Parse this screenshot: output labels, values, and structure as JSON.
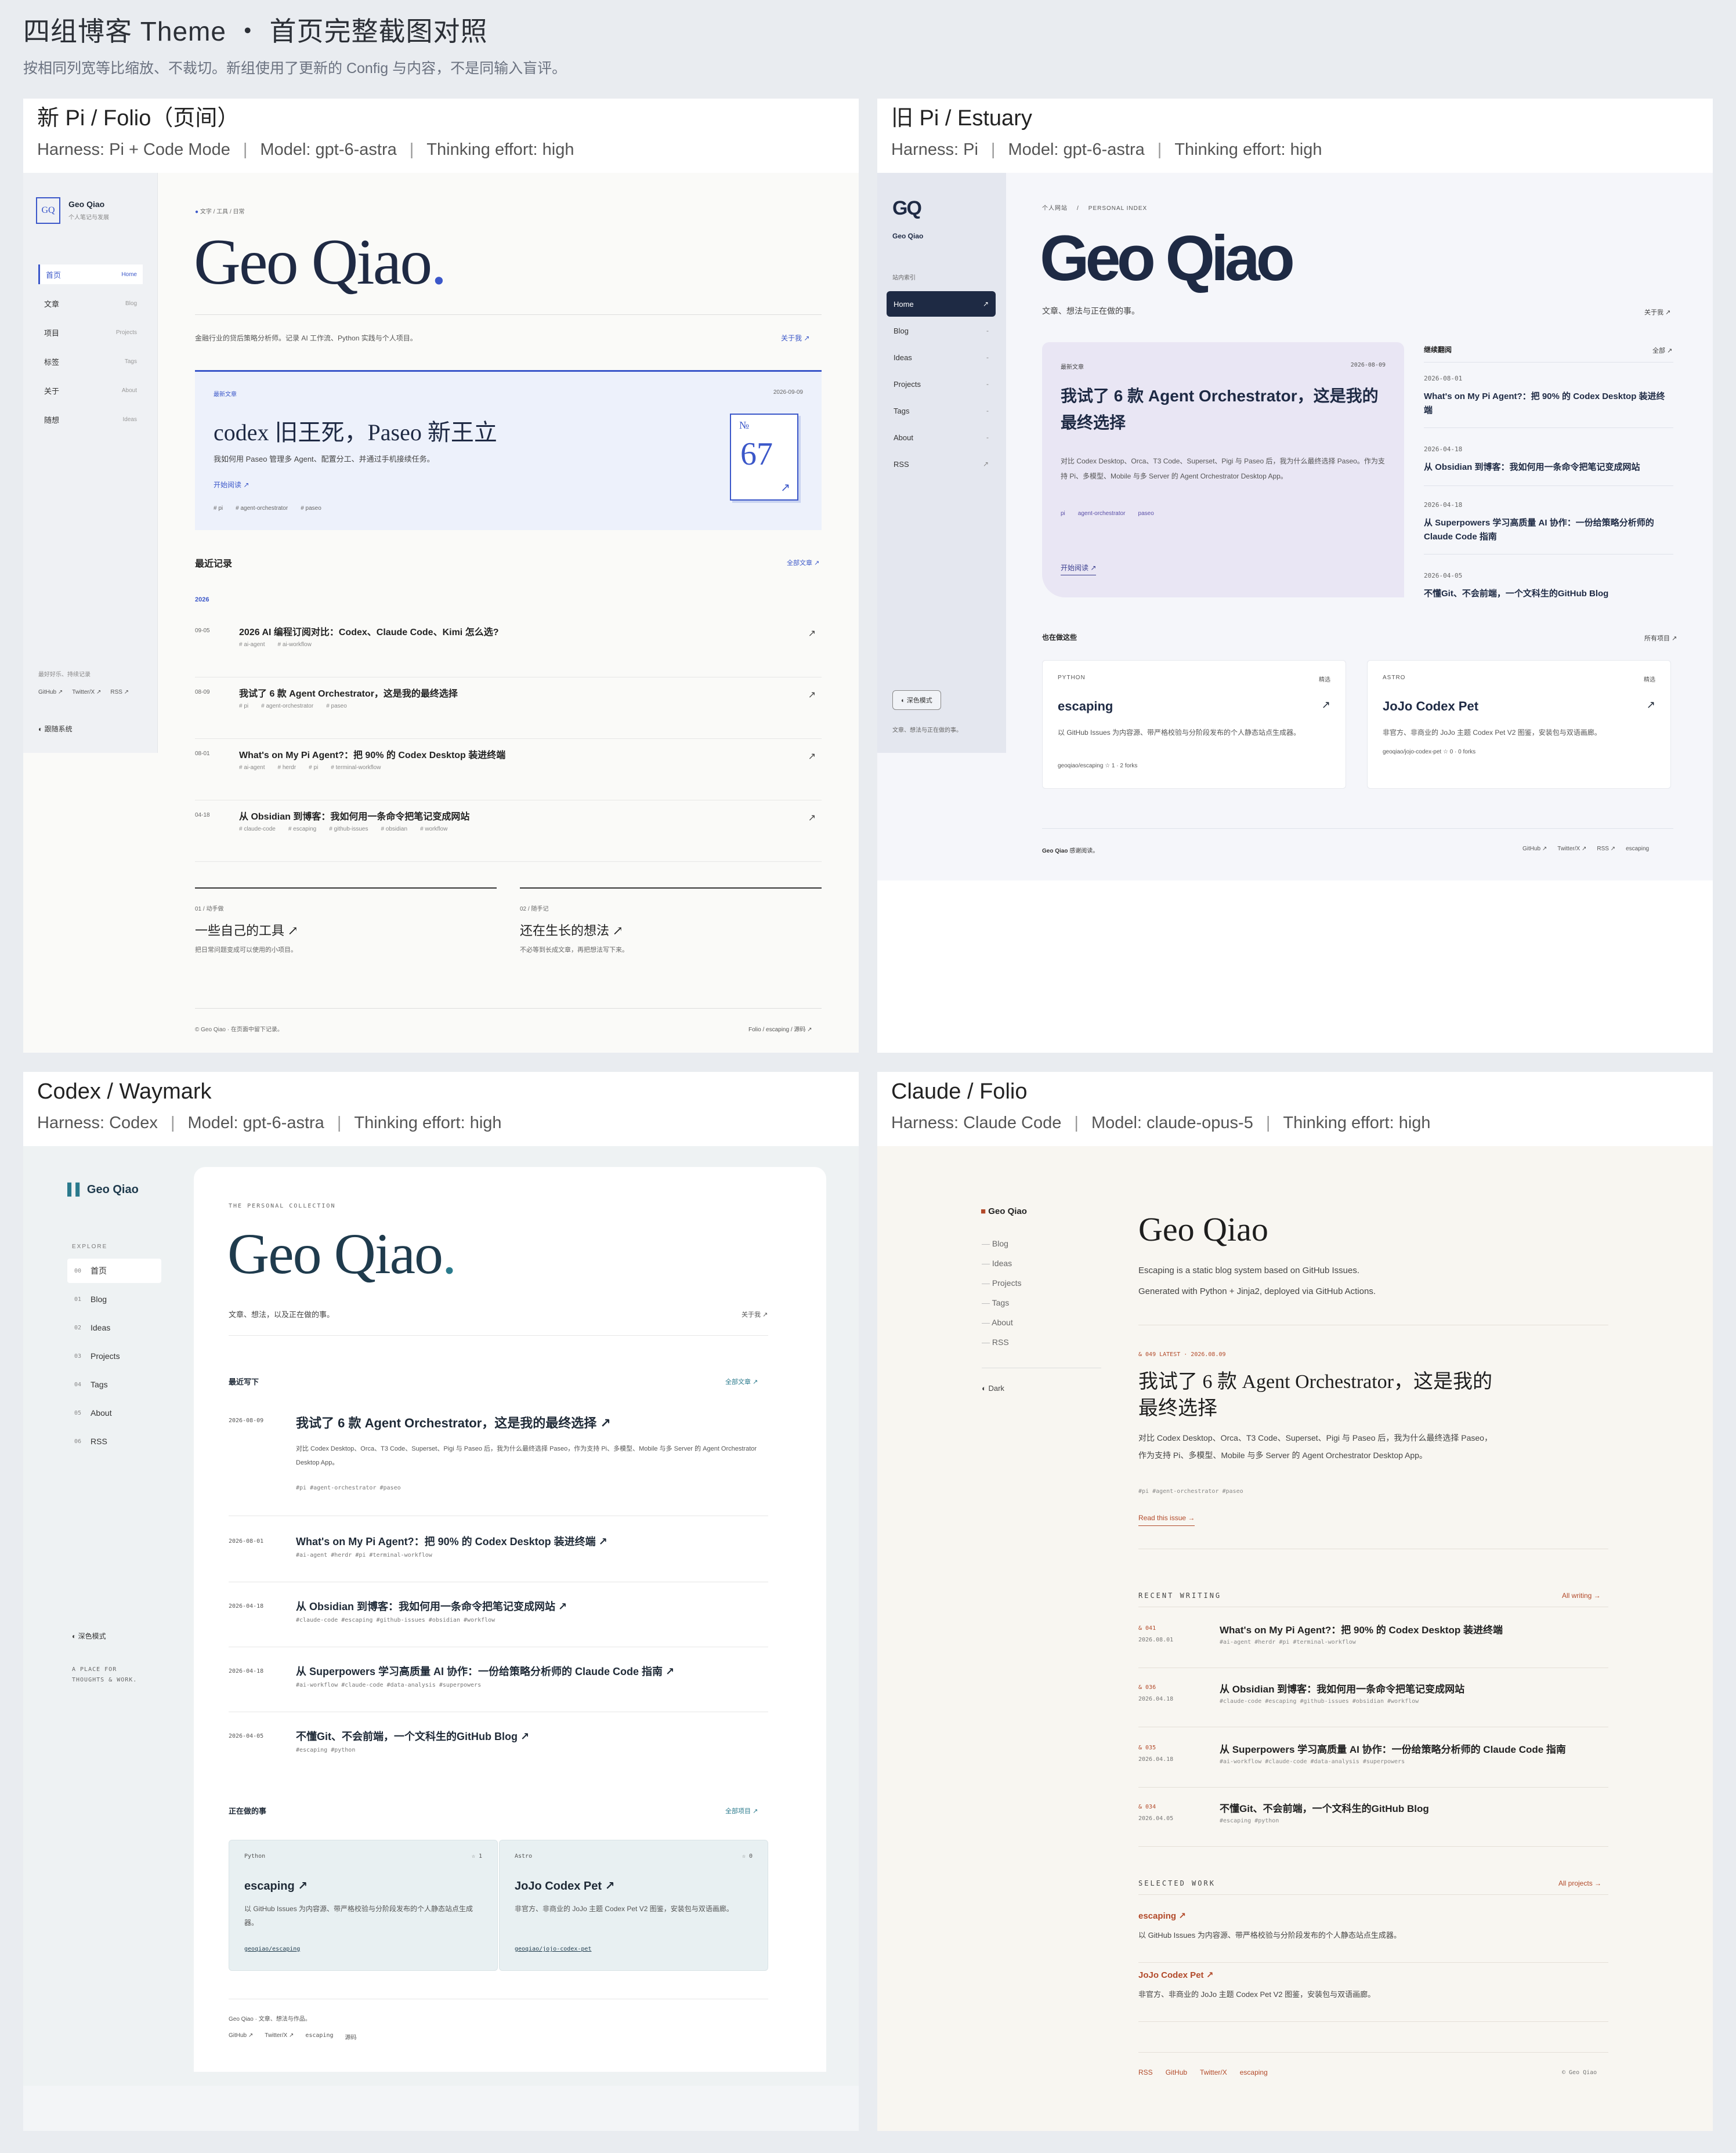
{
  "page": {
    "title": "四组博客 Theme ・ 首页完整截图对照",
    "subtitle": "按相同列宽等比缩放、不裁切。新组使用了更新的 Config 与内容，不是同输入盲评。"
  },
  "panels": [
    {
      "title": "新 Pi / Folio（页间）",
      "harness": "Harness: Pi + Code Mode",
      "model": "Model: gpt-6-astra",
      "effort": "Thinking effort: high"
    },
    {
      "title": "旧 Pi / Estuary",
      "harness": "Harness: Pi",
      "model": "Model: gpt-6-astra",
      "effort": "Thinking effort: high"
    },
    {
      "title": "Codex / Waymark",
      "harness": "Harness: Codex",
      "model": "Model: gpt-6-astra",
      "effort": "Thinking effort: high"
    },
    {
      "title": "Claude / Folio",
      "harness": "Harness: Claude Code",
      "model": "Model: claude-opus-5",
      "effort": "Thinking effort: high"
    }
  ],
  "p1": {
    "logo": "GQ",
    "name": "Geo Qiao",
    "tagline": "个人笔记与发展",
    "nav": [
      {
        "zh": "首页",
        "en": "Home"
      },
      {
        "zh": "文章",
        "en": "Blog"
      },
      {
        "zh": "项目",
        "en": "Projects"
      },
      {
        "zh": "标签",
        "en": "Tags"
      },
      {
        "zh": "关于",
        "en": "About"
      },
      {
        "zh": "随想",
        "en": "Ideas"
      }
    ],
    "side_note": "最好好乐、持续记录",
    "side_links": [
      "GitHub ↗",
      "Twitter/X ↗",
      "RSS ↗"
    ],
    "theme": "跟随系统",
    "eyebrow": "文字 / 工具 / 日常",
    "hero": "Geo Qiao",
    "hero_dot": ".",
    "intro": "金融行业的贷后策略分析师。记录 AI 工作流、Python 实践与个人项目。",
    "about": "关于我 ↗",
    "feat": {
      "label": "最新文章",
      "date": "2026-09-09",
      "title": "codex 旧王死，Paseo 新王立",
      "desc": "我如何用 Paseo 管理多 Agent、配置分工、并通过手机接续任务。",
      "cta": "开始阅读 ↗",
      "tags": [
        "# pi",
        "# agent-orchestrator",
        "# paseo"
      ],
      "no_label": "№",
      "no": "67",
      "arrow": "↗"
    },
    "recent_label": "最近记录",
    "recent_all": "全部文章 ↗",
    "year": "2026",
    "posts": [
      {
        "date": "09-05",
        "title": "2026 AI 编程订阅对比：Codex、Claude Code、Kimi 怎么选?",
        "tags": [
          "# ai-agent",
          "# ai-workflow"
        ]
      },
      {
        "date": "08-09",
        "title": "我试了 6 款 Agent Orchestrator，这是我的最终选择",
        "tags": [
          "# pi",
          "# agent-orchestrator",
          "# paseo"
        ]
      },
      {
        "date": "08-01",
        "title": "What's on My Pi Agent?：把 90% 的 Codex Desktop 装进终端",
        "tags": [
          "# ai-agent",
          "# herdr",
          "# pi",
          "# terminal-workflow"
        ]
      },
      {
        "date": "04-18",
        "title": "从 Obsidian 到博客：我如何用一条命令把笔记变成网站",
        "tags": [
          "# claude-code",
          "# escaping",
          "# github-issues",
          "# obsidian",
          "# workflow"
        ]
      }
    ],
    "sec1": {
      "label": "01 / 动手做",
      "title": "一些自己的工具 ↗",
      "desc": "把日常问题变成可以使用的小项目。"
    },
    "sec2": {
      "label": "02 / 随手记",
      "title": "还在生长的想法 ↗",
      "desc": "不必等到长成文章，再把想法写下来。"
    },
    "foot_left": "© Geo Qiao · 在页面中留下记录。",
    "foot_right": "Folio / escaping / 源码 ↗"
  },
  "p2": {
    "logo": "GQ",
    "name": "Geo Qiao",
    "nav_label": "站内索引",
    "nav": [
      "Home",
      "Blog",
      "Ideas",
      "Projects",
      "Tags",
      "About",
      "RSS"
    ],
    "nav_icons": [
      "↗",
      "-",
      "-",
      "-",
      "-",
      "-",
      "↗"
    ],
    "dark": "深色模式",
    "side_note": "文章、想法与正在做的事。",
    "eyebrow1": "个人网站",
    "eyebrow2": "PERSONAL INDEX",
    "hero": "Geo Qiao",
    "intro": "文章、想法与正在做的事。",
    "about": "关于我 ↗",
    "feat": {
      "label": "最新文章",
      "date": "2026-08-09",
      "title": "我试了 6 款 Agent Orchestrator，这是我的最终选择",
      "desc": "对比 Codex Desktop、Orca、T3 Code、Superset、Pigi 与 Paseo 后，我为什么最终选择 Paseo。作为支持 Pi、多模型、Mobile 与多 Server 的 Agent Orchestrator Desktop App。",
      "tags": [
        "pi",
        "agent-orchestrator",
        "paseo"
      ],
      "cta": "开始阅读 ↗"
    },
    "cont_label": "继续翻阅",
    "cont_all": "全部 ↗",
    "cont": [
      {
        "date": "2026-08-01",
        "title": "What's on My Pi Agent?：把 90% 的 Codex Desktop 装进终端"
      },
      {
        "date": "2026-04-18",
        "title": "从 Obsidian 到博客：我如何用一条命令把笔记变成网站"
      },
      {
        "date": "2026-04-18",
        "title": "从 Superpowers 学习高质量 AI 协作：一份给策略分析师的 Claude Code 指南"
      },
      {
        "date": "2026-04-05",
        "title": "不懂Git、不会前端，一个文科生的GitHub Blog"
      }
    ],
    "proj_label": "也在做这些",
    "proj_all": "所有项目 ↗",
    "projects": [
      {
        "lang": "PYTHON",
        "pick": "精选",
        "name": "escaping",
        "desc": "以 GitHub Issues 为内容源、带严格校验与分阶段发布的个人静态站点生成器。",
        "repo": "geoqiao/escaping",
        "stats": "☆ 1 · 2 forks"
      },
      {
        "lang": "ASTRO",
        "pick": "精选",
        "name": "JoJo Codex Pet",
        "desc": "非官方、非商业的 JoJo 主题 Codex Pet V2 图鉴，安装包与双语画廊。",
        "repo": "geoqiao/jojo-codex-pet",
        "stats": "☆ 0 · 0 forks"
      }
    ],
    "foot_left": "Geo Qiao",
    "foot_left2": "感谢阅读。",
    "foot_links": [
      "GitHub ↗",
      "Twitter/X ↗",
      "RSS ↗",
      "escaping"
    ]
  },
  "p3": {
    "logo_name": "Geo Qiao",
    "explore": "EXPLORE",
    "nav": [
      {
        "n": "00",
        "t": "首页"
      },
      {
        "n": "01",
        "t": "Blog"
      },
      {
        "n": "02",
        "t": "Ideas"
      },
      {
        "n": "03",
        "t": "Projects"
      },
      {
        "n": "04",
        "t": "Tags"
      },
      {
        "n": "05",
        "t": "About"
      },
      {
        "n": "06",
        "t": "RSS"
      }
    ],
    "dark": "深色模式",
    "motto": "A PLACE FOR THOUGHTS & WORK.",
    "eyebrow": "THE PERSONAL COLLECTION",
    "hero": "Geo Qiao",
    "hero_dot": ".",
    "intro": "文章、想法，以及正在做的事。",
    "about": "关于我 ↗",
    "recent_label": "最近写下",
    "recent_all": "全部文章 ↗",
    "posts": [
      {
        "date": "2026-08-09",
        "title": "我试了 6 款 Agent Orchestrator，这是我的最终选择 ↗",
        "desc": "对比 Codex Desktop、Orca、T3 Code、Superset、Pigi 与 Paseo 后，我为什么最终选择 Paseo，作为支持 Pi、多模型、Mobile 与多 Server 的 Agent Orchestrator Desktop App。",
        "tags": "#pi  #agent-orchestrator  #paseo"
      },
      {
        "date": "2026-08-01",
        "title": "What's on My Pi Agent?：把 90% 的 Codex Desktop 装进终端 ↗",
        "desc": "",
        "tags": "#ai-agent  #herdr  #pi  #terminal-workflow"
      },
      {
        "date": "2026-04-18",
        "title": "从 Obsidian 到博客：我如何用一条命令把笔记变成网站 ↗",
        "desc": "",
        "tags": "#claude-code  #escaping  #github-issues  #obsidian  #workflow"
      },
      {
        "date": "2026-04-18",
        "title": "从 Superpowers 学习高质量 AI 协作：一份给策略分析师的 Claude Code 指南 ↗",
        "desc": "",
        "tags": "#ai-workflow  #claude-code  #data-analysis  #superpowers"
      },
      {
        "date": "2026-04-05",
        "title": "不懂Git、不会前端，一个文科生的GitHub Blog ↗",
        "desc": "",
        "tags": "#escaping  #python"
      }
    ],
    "proj_label": "正在做的事",
    "proj_all": "全部项目 ↗",
    "projects": [
      {
        "lang": "Python",
        "star": "☆ 1",
        "name": "escaping ↗",
        "desc": "以 GitHub Issues 为内容源、带严格校验与分阶段发布的个人静态站点生成器。",
        "repo": "geoqiao/escaping"
      },
      {
        "lang": "Astro",
        "star": "☆ 0",
        "name": "JoJo Codex Pet ↗",
        "desc": "非官方、非商业的 JoJo 主题 Codex Pet V2 图鉴，安装包与双语画廊。",
        "repo": "geoqiao/jojo-codex-pet"
      }
    ],
    "foot1": "Geo Qiao  ·  文章、想法与作品。",
    "foot2": [
      "GitHub ↗",
      "Twitter/X ↗",
      "escaping",
      "源码"
    ]
  },
  "p4": {
    "name": "Geo Qiao",
    "nav": [
      "Blog",
      "Ideas",
      "Projects",
      "Tags",
      "About",
      "RSS"
    ],
    "dark": "Dark",
    "hero": "Geo Qiao",
    "intro1": "Escaping is a static blog system based on GitHub Issues.",
    "intro2": "Generated with Python + Jinja2, deployed via GitHub Actions.",
    "latest": "& 049   LATEST · 2026.08.09",
    "feat_title": "我试了 6 款 Agent Orchestrator，这是我的最终选择",
    "feat_desc": "对比 Codex Desktop、Orca、T3 Code、Superset、Pigi 与 Paseo 后，我为什么最终选择 Paseo，作为支持 Pi、多模型、Mobile 与多 Server 的 Agent Orchestrator Desktop App。",
    "feat_tags": "#pi  #agent-orchestrator  #paseo",
    "read": "Read this issue →",
    "recent_label": "RECENT WRITING",
    "recent_all": "All writing →",
    "posts": [
      {
        "n": "& 041",
        "d": "2026.08.01",
        "t": "What's on My Pi Agent?：把 90% 的 Codex Desktop 装进终端",
        "g": "#ai-agent  #herdr  #pi  #terminal-workflow"
      },
      {
        "n": "& 036",
        "d": "2026.04.18",
        "t": "从 Obsidian 到博客：我如何用一条命令把笔记变成网站",
        "g": "#claude-code  #escaping  #github-issues  #obsidian  #workflow"
      },
      {
        "n": "& 035",
        "d": "2026.04.18",
        "t": "从 Superpowers 学习高质量 AI 协作：一份给策略分析师的 Claude Code 指南",
        "g": "#ai-workflow  #claude-code  #data-analysis  #superpowers"
      },
      {
        "n": "& 034",
        "d": "2026.04.05",
        "t": "不懂Git、不会前端，一个文科生的GitHub Blog",
        "g": "#escaping  #python"
      }
    ],
    "work_label": "SELECTED WORK",
    "work_all": "All projects →",
    "works": [
      {
        "t": "escaping ↗",
        "d": "以 GitHub Issues 为内容源、带严格校验与分阶段发布的个人静态站点生成器。"
      },
      {
        "t": "JoJo Codex Pet ↗",
        "d": "非官方、非商业的 JoJo 主题 Codex Pet V2 图鉴，安装包与双语画廊。"
      }
    ],
    "foot_links": [
      "RSS",
      "GitHub",
      "Twitter/X",
      "escaping"
    ],
    "foot_right": "© Geo Qiao"
  },
  "colors": {
    "bg": "#e9ecf0",
    "p1_accent": "#3b57c9",
    "p2_dark": "#1e2a44",
    "p4_accent": "#b24a2a"
  }
}
